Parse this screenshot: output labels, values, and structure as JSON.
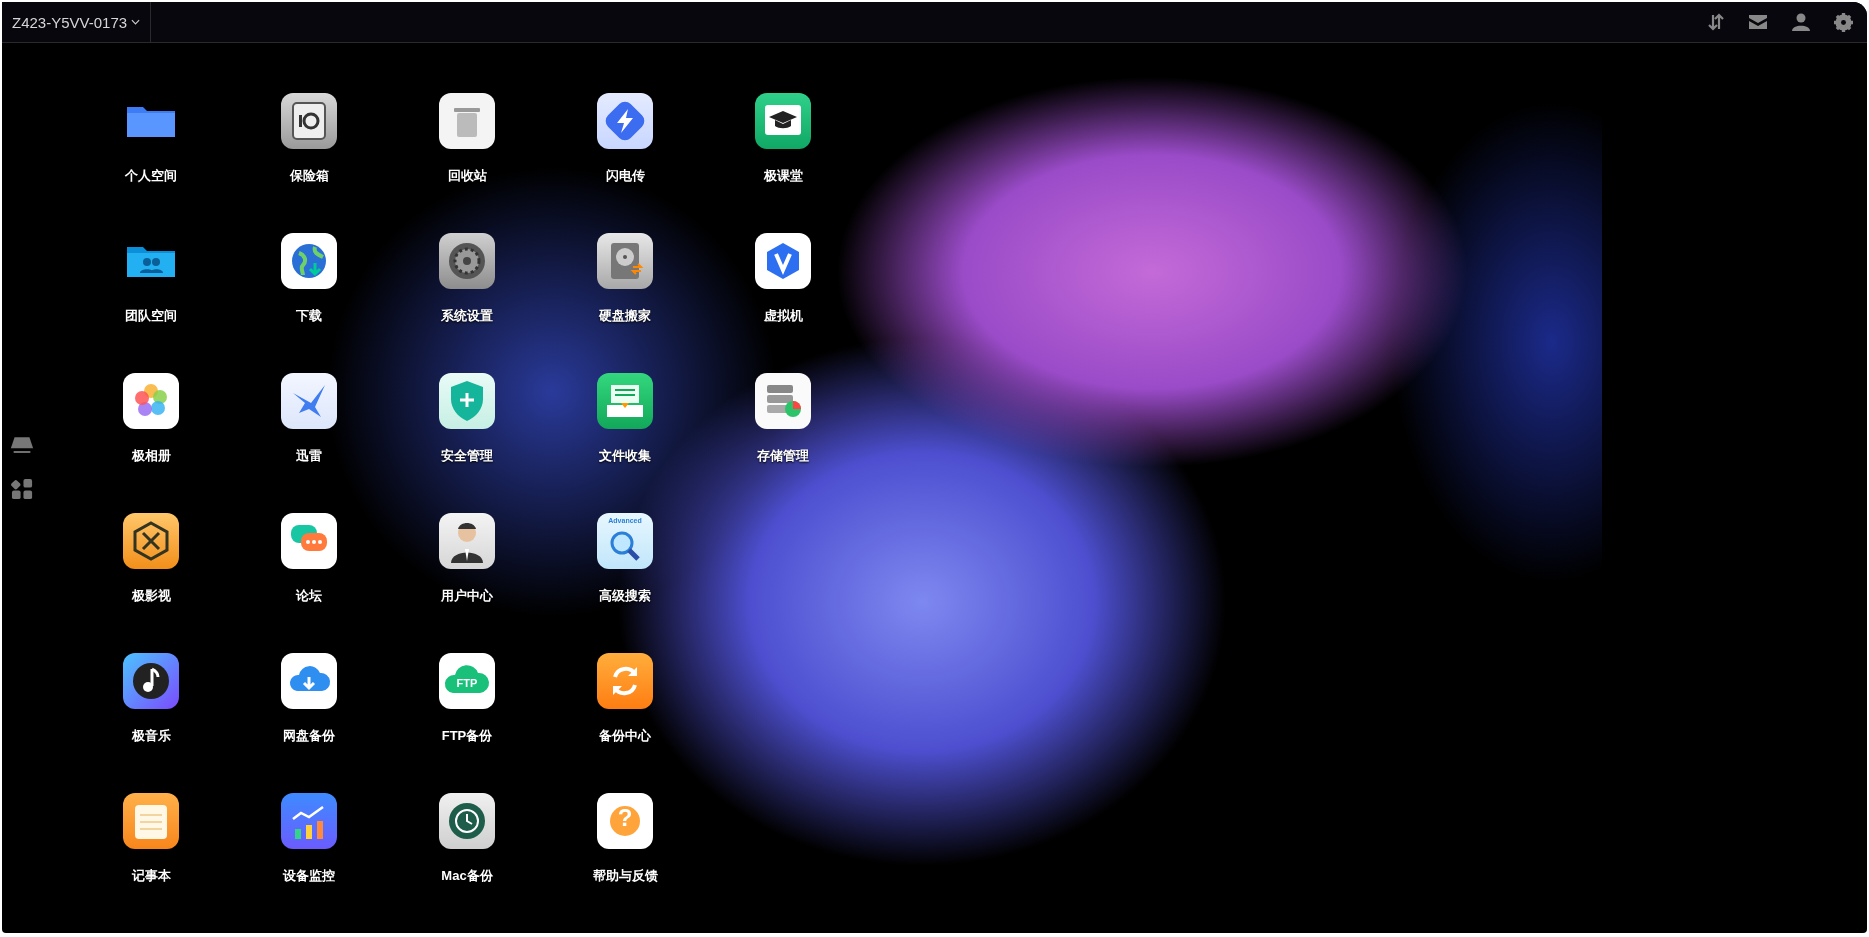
{
  "top_bar": {
    "device_name": "Z423-Y5VV-0173"
  },
  "app_rows": [
    [
      {
        "label": "个人空间",
        "kind": "folder"
      },
      {
        "label": "保险箱",
        "kind": "safe"
      },
      {
        "label": "回收站",
        "kind": "trash"
      },
      {
        "label": "闪电传",
        "kind": "flash"
      },
      {
        "label": "极课堂",
        "kind": "course"
      }
    ],
    [
      {
        "label": "团队空间",
        "kind": "team"
      },
      {
        "label": "下载",
        "kind": "download"
      },
      {
        "label": "系统设置",
        "kind": "settings"
      },
      {
        "label": "硬盘搬家",
        "kind": "disk"
      },
      {
        "label": "虚拟机",
        "kind": "vm"
      }
    ],
    [
      {
        "label": "极相册",
        "kind": "photos"
      },
      {
        "label": "迅雷",
        "kind": "bird"
      },
      {
        "label": "安全管理",
        "kind": "shield"
      },
      {
        "label": "文件收集",
        "kind": "collect"
      },
      {
        "label": "存储管理",
        "kind": "storage"
      }
    ],
    [
      {
        "label": "极影视",
        "kind": "video"
      },
      {
        "label": "论坛",
        "kind": "forum"
      },
      {
        "label": "用户中心",
        "kind": "user"
      },
      {
        "label": "高级搜索",
        "kind": "search",
        "icon_text": "Advanced"
      }
    ],
    [
      {
        "label": "极音乐",
        "kind": "music"
      },
      {
        "label": "网盘备份",
        "kind": "cloud"
      },
      {
        "label": "FTP备份",
        "kind": "ftp",
        "icon_text": "FTP"
      },
      {
        "label": "备份中心",
        "kind": "sync"
      }
    ],
    [
      {
        "label": "记事本",
        "kind": "notes"
      },
      {
        "label": "设备监控",
        "kind": "monitor"
      },
      {
        "label": "Mac备份",
        "kind": "clock"
      },
      {
        "label": "帮助与反馈",
        "kind": "help",
        "icon_text": "?"
      }
    ]
  ]
}
